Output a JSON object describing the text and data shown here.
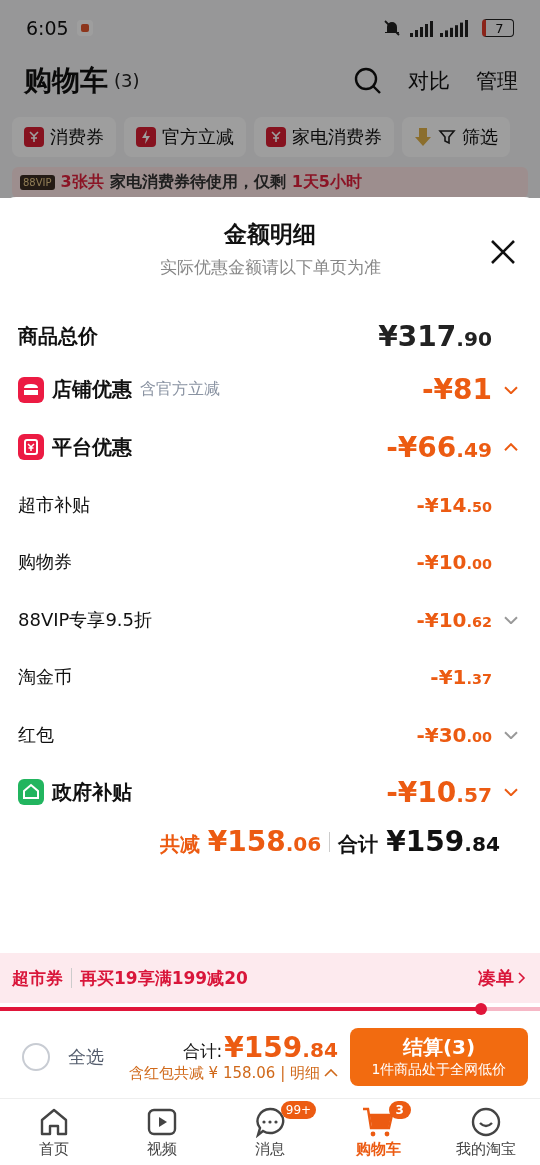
{
  "status_bar": {
    "time": "6:05",
    "battery": "7"
  },
  "header": {
    "title": "购物车",
    "count": "(3)",
    "actions": [
      "对比",
      "管理"
    ]
  },
  "chips": [
    {
      "label": "消费券",
      "kind": "yen"
    },
    {
      "label": "官方立减",
      "kind": "bolt"
    },
    {
      "label": "家电消费券",
      "kind": "yen"
    },
    {
      "label": "筛选",
      "kind": "filter"
    }
  ],
  "notice": {
    "badge": "88VIP",
    "parts": [
      "3张共",
      "家电消费券待使用，仅剩",
      "1天5小时"
    ]
  },
  "sheet": {
    "title": "金额明细",
    "subtitle": "实际优惠金额请以下单页为准",
    "total": {
      "label": "商品总价",
      "amount": "¥317.90"
    },
    "rows": [
      {
        "kind": "store",
        "label": "店铺优惠",
        "note": "含官方立减",
        "amount": "-¥81",
        "expanded": false
      },
      {
        "kind": "platform",
        "label": "平台优惠",
        "amount": "-¥66.49",
        "expanded": true
      },
      {
        "kind": "sub",
        "label": "超市补贴",
        "amount": "-¥14.50",
        "expandable": false
      },
      {
        "kind": "sub",
        "label": "购物券",
        "amount": "-¥10.00",
        "expandable": false
      },
      {
        "kind": "sub",
        "label": "88VIP专享9.5折",
        "amount": "-¥10.62",
        "expandable": true
      },
      {
        "kind": "sub",
        "label": "淘金币",
        "amount": "-¥1.37",
        "expandable": false
      },
      {
        "kind": "sub",
        "label": "红包",
        "amount": "-¥30.00",
        "expandable": true
      },
      {
        "kind": "gov",
        "label": "政府补贴",
        "amount": "-¥10.57",
        "expanded": false
      }
    ],
    "summary": {
      "saved_label": "共减",
      "saved": "¥158.06",
      "total_label": "合计",
      "total": "¥159.84"
    }
  },
  "coupon_bar": {
    "tag": "超市券",
    "text": "再买19享满199减20",
    "action": "凑单",
    "level": 0.89
  },
  "checkout": {
    "select_all": {
      "label": "全选",
      "checked": false
    },
    "total_label": "合计:",
    "total": "¥159.84",
    "saved_text": "含红包共减 ¥ 158.06 | 明细",
    "button": "结算(3)",
    "button_note": "1件商品处于全网低价"
  },
  "tabs": [
    {
      "label": "首页",
      "selected": false
    },
    {
      "label": "视频",
      "selected": false
    },
    {
      "label": "消息",
      "selected": false,
      "badge": "99+"
    },
    {
      "label": "购物车",
      "selected": true,
      "badge": "3"
    },
    {
      "label": "我的淘宝",
      "selected": false
    }
  ]
}
